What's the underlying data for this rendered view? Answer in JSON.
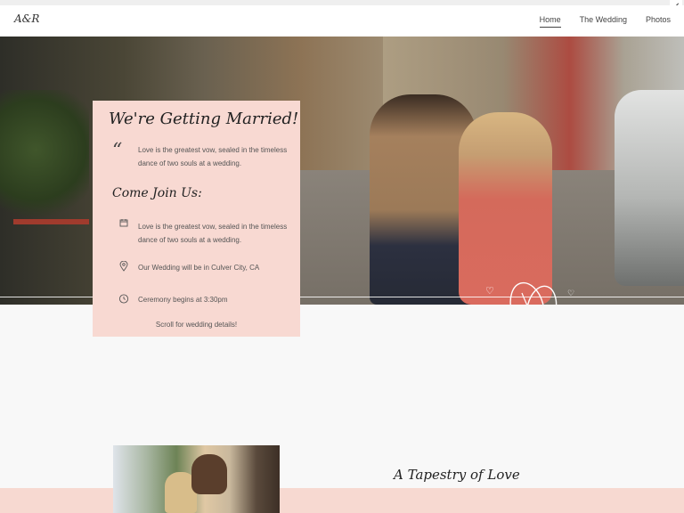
{
  "header": {
    "logo": "A&R",
    "nav": [
      "Home",
      "The Wedding",
      "Photos"
    ],
    "active_nav": "Home"
  },
  "hero": {
    "card": {
      "title": "We're Getting Married!",
      "quote_text": "Love is the greatest vow, sealed in the timeless dance of two souls at a wedding.",
      "subtitle": "Come Join Us:",
      "items": [
        {
          "icon": "calendar-icon",
          "text": "Love is the greatest vow, sealed in the timeless dance of two souls at a wedding."
        },
        {
          "icon": "location-pin-icon",
          "text": "Our Wedding will be in Culver City, CA"
        },
        {
          "icon": "clock-icon",
          "text": "Ceremony begins at 3:30pm"
        }
      ],
      "scroll_text": "Scroll for wedding details!"
    }
  },
  "section2": {
    "title": "A Tapestry of Love"
  },
  "colors": {
    "card_bg": "#f8d9d2",
    "band_bg": "#f7d9d1",
    "page_bg": "#f8f8f8"
  }
}
